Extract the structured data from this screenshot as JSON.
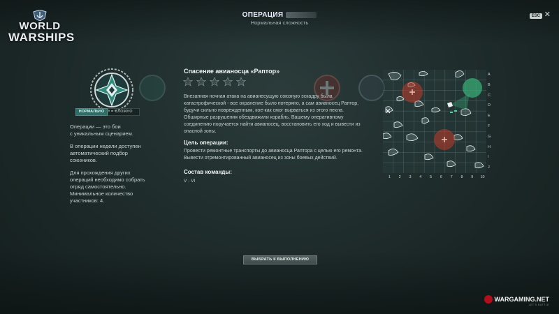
{
  "header": {
    "title": "ОПЕРАЦИЯ",
    "subtitle": "Нормальная сложность",
    "esc_label": "ESC",
    "close_glyph": "✕"
  },
  "logo": {
    "line1": "WORLD",
    "line2": "WARSHIPS"
  },
  "difficulty": {
    "normal": "НОРМАЛЬНО",
    "hard": "СЛОЖНО"
  },
  "left_info": {
    "p1": "Операции — это бои\nс уникальным сценарием.",
    "p2": "В операции недели доступен\nавтоматический подбор\nсоюзников.",
    "p3": "Для прохождения других\nопераций необходимо собрать\nотряд самостоятельно.\nМинимальное количество\nучастников: 4."
  },
  "operation": {
    "title": "Спасение авианосца «Раптор»",
    "stars_total": 5,
    "description": "Внезапная ночная атака на авианесущую союзную эскадру была катастрофической - все охранение было потеряно, а сам авианосец Раптор, будучи сильно поврежденным, кое-как смог вырваться из этого пекла. Обширные разрушения обездвижили корабль. Вашему оперативному соединению поручается найти авианосец, восстановить его ход и вывести из опасной зоны.",
    "goal_title": "Цель операции:",
    "goal_text": "Провести ремонтные транспорты до авианосца Раптора с целью его ремонта. Вывести отремонтированный авианосец из зоны боевых действий.",
    "team_title": "Состав команды:",
    "team_value": "V - VI"
  },
  "map": {
    "columns": [
      "1",
      "2",
      "3",
      "4",
      "5",
      "6",
      "7",
      "8",
      "9",
      "10"
    ],
    "rows": [
      "A",
      "B",
      "C",
      "D",
      "E",
      "F",
      "G",
      "H",
      "I",
      "J"
    ]
  },
  "select_button": "ВЫБРАТЬ К ВЫПОЛНЕНИЮ",
  "footer": {
    "brand": "WARGAMING.NET",
    "tagline": "LET'S BATTLE"
  },
  "colors": {
    "accent": "#2d6f66",
    "enemy": "#c23a2a",
    "ally": "#39b37a",
    "brand_red": "#b30e1c"
  }
}
